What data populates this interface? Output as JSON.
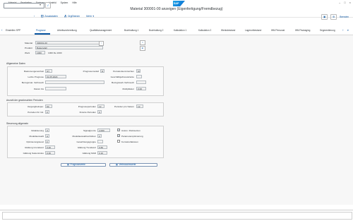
{
  "menu": [
    "Material",
    "Bearbeiten",
    "Springen",
    "Umfeld",
    "System",
    "Hilfe"
  ],
  "window": {
    "title": "Material 300001-00 anzeigen (Eigenfertigung/Fremdbezug)"
  },
  "toolbar": {
    "zusatzdaten": "Zusatzdaten",
    "orgebenen": "OrgEbenen",
    "mehr": "Mehr",
    "beenden": "Beenden"
  },
  "tabs": [
    "Einstellen SPP",
    "Prognose",
    "Arbeitsvorbereitung",
    "Qualitätsmanagement",
    "Buchhaltung 1",
    "Buchhaltung 2",
    "Kalkulation 1",
    "Kalkulation 2",
    "Werksbestand",
    "Lagerortbestand",
    "WM Personal",
    "WM Packaging",
    "Segmentierung"
  ],
  "header": {
    "material_label": "Material",
    "material_value": "300001-00",
    "text_label": "Produkt",
    "text_value": "Batteriefall",
    "werk_label": "Werk",
    "werk_value": "1000",
    "werk_text": "1000 De 1000"
  },
  "allgemein": {
    "title": "Allgemeine Daten",
    "basismengeneinheit_label": "Basismengeneinheit",
    "basismengeneinheit_value": "ST",
    "prognosemodell_label": "Prognosemodell",
    "prognosemodell_value": "D",
    "periodenkennzeichen_label": "Periodenkennzeichen",
    "periodenkennzeichen_value": "M",
    "letzte_prognose_label": "Letzte Prognose",
    "letzte_prognose_value": "01.05.2024",
    "geschjahresvariante_label": "Geschäftsjahresvariante",
    "geschjahresvariante_value": "",
    "bezugsmat_label": "Bezugsmat. Verbrauch",
    "bezugsmat_value": "",
    "bezugswerk_label": "Bezugswerk Verbrauch",
    "bezugswerk_value": "",
    "datum_bis_label": "Datum bis",
    "datum_bis_value": "",
    "multiplikator_label": "Multiplikator",
    "multiplikator_value": "0,00"
  },
  "perioden": {
    "title": "Anzahl der gewünschten Perioden",
    "vergperioden_label": "Vergangheitsper.",
    "vergperioden_value": "60",
    "prognoseperioden_label": "Prognoseperioden",
    "prognoseperioden_value": "12",
    "perioden_saison_label": "Perioden pro Saison",
    "perioden_saison_value": "12",
    "perioden_init_label": "Perioden für Init.",
    "perioden_init_value": "0",
    "fixierte_label": "Fixierte Perioden",
    "fixierte_value": "0"
  },
  "steuerung": {
    "title": "Steuerung allgemein",
    "initialisierung_label": "Initialisierung",
    "initialisierung_value": "X",
    "signalgrenze_label": "Signalgrenze",
    "signalgrenze_value": "4,000",
    "ruecksetz_label": "Autom. Rücksetzen",
    "ruecksetz_checked": true,
    "modellauswahl_label": "Modellauswahl",
    "modellauswahl_value": "A",
    "modellauswahlverfahren_label": "Modellauswahlverfahren",
    "modellauswahlverfahren_value": "2",
    "param_label": "Parameteroptimierung",
    "param_checked": true,
    "optimierungslevel_label": "Optimierungslevel",
    "optimierungslevel_value": "F",
    "gewichtungsgruppe_label": "Gewichtungsgruppe",
    "gewichtungsgruppe_value": "",
    "korrekturfaktoren_label": "Korrekturfaktoren",
    "korrekturfaktoren_checked": false,
    "gl_grundwert_label": "Glättung Grundwert",
    "gl_grundwert_value": "0,20",
    "gl_trendwert_label": "Glättung Trendwert",
    "gl_trendwert_value": "0,80",
    "gl_saisonindex_label": "Glättung Saisonindex",
    "gl_saisonindex_value": "0,30",
    "gl_mad_label": "Glättung MAD",
    "gl_mad_value": "0,10"
  },
  "buttons": {
    "prognosewerte": "Prognosewerte",
    "verbrauchswerte": "Verbrauchswerte"
  }
}
